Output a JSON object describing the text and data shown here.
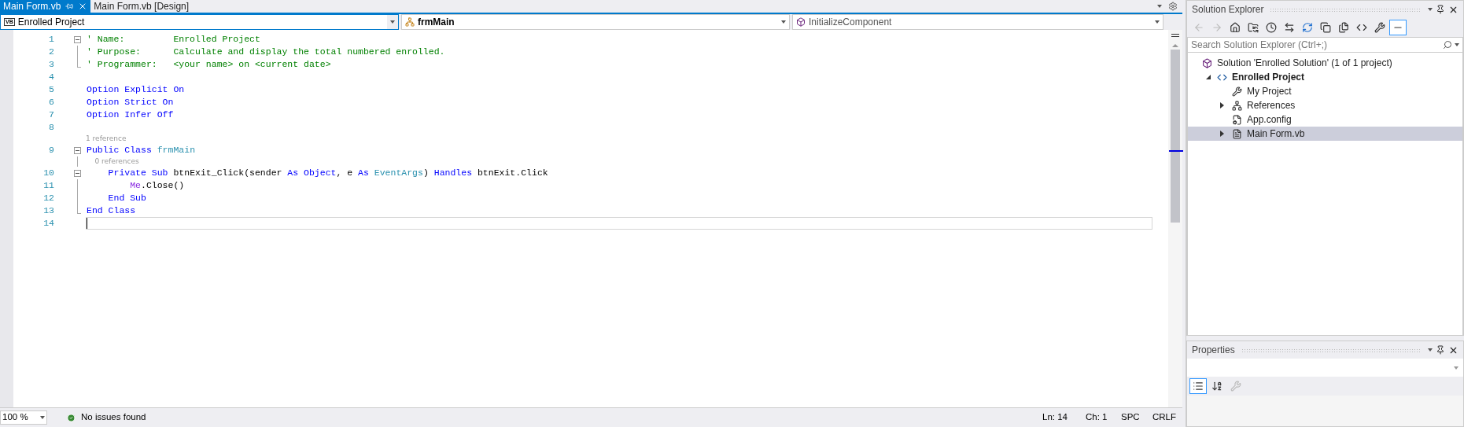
{
  "editor_tabs": [
    {
      "label": "Main Form.vb",
      "selected": true,
      "pinned": true
    },
    {
      "label": "Main Form.vb [Design]",
      "selected": false,
      "pinned": false
    }
  ],
  "navigation_bar": {
    "project_icon": "VB",
    "project": "Enrolled Project",
    "class": "frmMain",
    "member": "InitializeComponent"
  },
  "code_lines": [
    {
      "kind": "code",
      "number": "1",
      "collapsible": true,
      "guide": false,
      "block_end": false,
      "current": false,
      "segments": [
        {
          "kind": "comment",
          "text": "' Name:         Enrolled Project"
        }
      ]
    },
    {
      "kind": "code",
      "number": "2",
      "collapsible": false,
      "guide": true,
      "block_end": false,
      "current": false,
      "segments": [
        {
          "kind": "comment",
          "text": "' Purpose:      Calculate and display the total numbered enrolled."
        }
      ]
    },
    {
      "kind": "code",
      "number": "3",
      "collapsible": false,
      "guide": false,
      "block_end": true,
      "current": false,
      "segments": [
        {
          "kind": "comment",
          "text": "' Programmer:   <your name> on <current date>"
        }
      ]
    },
    {
      "kind": "code",
      "number": "4",
      "collapsible": false,
      "guide": false,
      "block_end": false,
      "current": false
    },
    {
      "kind": "code",
      "number": "5",
      "collapsible": false,
      "guide": false,
      "block_end": false,
      "current": false,
      "segments": [
        {
          "kind": "keyword",
          "text": "Option Explicit On"
        }
      ]
    },
    {
      "kind": "code",
      "number": "6",
      "collapsible": false,
      "guide": false,
      "block_end": false,
      "current": false,
      "segments": [
        {
          "kind": "keyword",
          "text": "Option Strict On"
        }
      ]
    },
    {
      "kind": "code",
      "number": "7",
      "collapsible": false,
      "guide": false,
      "block_end": false,
      "current": false,
      "segments": [
        {
          "kind": "keyword",
          "text": "Option Infer Off"
        }
      ]
    },
    {
      "kind": "code",
      "number": "8",
      "collapsible": false,
      "guide": false,
      "block_end": false,
      "current": false
    },
    {
      "kind": "codelens",
      "text": "1 reference",
      "collapsible": false,
      "guide": false,
      "block_end": false
    },
    {
      "kind": "code",
      "number": "9",
      "collapsible": true,
      "guide": false,
      "block_end": false,
      "current": false,
      "segments": [
        {
          "kind": "keyword",
          "text": "Public Class "
        },
        {
          "kind": "type",
          "text": "frmMain"
        }
      ]
    },
    {
      "kind": "codelens",
      "text": "    0 references",
      "collapsible": false,
      "guide": true,
      "block_end": false
    },
    {
      "kind": "code",
      "number": "10",
      "collapsible": true,
      "guide": false,
      "block_end": false,
      "current": false,
      "segments": [
        {
          "kind": "keyword",
          "text": "    Private Sub "
        },
        {
          "kind": "plain",
          "text": "btnExit_Click(sender "
        },
        {
          "kind": "keyword",
          "text": "As Object"
        },
        {
          "kind": "plain",
          "text": ", e "
        },
        {
          "kind": "keyword",
          "text": "As "
        },
        {
          "kind": "type",
          "text": "EventArgs"
        },
        {
          "kind": "plain",
          "text": ") "
        },
        {
          "kind": "keyword",
          "text": "Handles"
        },
        {
          "kind": "plain",
          "text": " btnExit.Click"
        }
      ]
    },
    {
      "kind": "code",
      "number": "11",
      "collapsible": false,
      "guide": true,
      "block_end": false,
      "current": false,
      "segments": [
        {
          "kind": "me",
          "text": "        Me"
        },
        {
          "kind": "plain",
          "text": ".Close()"
        }
      ]
    },
    {
      "kind": "code",
      "number": "12",
      "collapsible": false,
      "guide": true,
      "block_end": false,
      "current": false,
      "segments": [
        {
          "kind": "keyword",
          "text": "    End Sub"
        }
      ]
    },
    {
      "kind": "code",
      "number": "13",
      "collapsible": false,
      "guide": false,
      "block_end": true,
      "current": false,
      "segments": [
        {
          "kind": "keyword",
          "text": "End Class"
        }
      ]
    },
    {
      "kind": "code",
      "number": "14",
      "collapsible": false,
      "guide": false,
      "block_end": false,
      "current": true
    }
  ],
  "status_bar": {
    "zoom": "100 %",
    "issues": "No issues found",
    "line": "Ln: 14",
    "column": "Ch: 1",
    "whitespace": "SPC",
    "line_ending": "CRLF"
  },
  "solution_explorer": {
    "title": "Solution Explorer",
    "toolbar": [
      {
        "kind": "back",
        "disabled": true,
        "selected": false
      },
      {
        "kind": "forward",
        "disabled": true,
        "selected": false
      },
      {
        "kind": "home",
        "disabled": false,
        "selected": false
      },
      {
        "kind": "switch-views",
        "disabled": false,
        "selected": false
      },
      {
        "kind": "history",
        "disabled": false,
        "selected": false
      },
      {
        "kind": "sync",
        "disabled": false,
        "selected": false
      },
      {
        "kind": "refresh",
        "disabled": false,
        "selected": false
      },
      {
        "kind": "collapse",
        "disabled": false,
        "selected": false
      },
      {
        "kind": "show-all",
        "disabled": false,
        "selected": false
      },
      {
        "kind": "view-code",
        "disabled": false,
        "selected": false
      },
      {
        "kind": "properties",
        "disabled": false,
        "selected": false
      },
      {
        "kind": "preview",
        "disabled": false,
        "selected": true
      }
    ],
    "search": {
      "placeholder": "Search Solution Explorer (Ctrl+;)"
    },
    "tree": [
      {
        "kind": "solution",
        "label": "Solution 'Enrolled Solution' (1 of 1 project)",
        "selected": false,
        "children": [
          {
            "kind": "project",
            "label": "Enrolled Project",
            "selected": false,
            "expanded": true,
            "children": [
              {
                "kind": "settings",
                "label": "My Project",
                "selected": false
              },
              {
                "kind": "references",
                "label": "References",
                "selected": false,
                "expanded": false
              },
              {
                "kind": "config",
                "label": "App.config",
                "selected": false
              },
              {
                "kind": "form",
                "label": "Main Form.vb",
                "selected": true,
                "expanded": false
              }
            ]
          }
        ]
      }
    ]
  },
  "properties": {
    "title": "Properties",
    "toolbar": [
      {
        "kind": "categorized",
        "selected": true,
        "disabled": false
      },
      {
        "kind": "alphabetical",
        "selected": false,
        "disabled": false
      },
      {
        "kind": "property-pages",
        "selected": false,
        "disabled": true
      }
    ]
  }
}
